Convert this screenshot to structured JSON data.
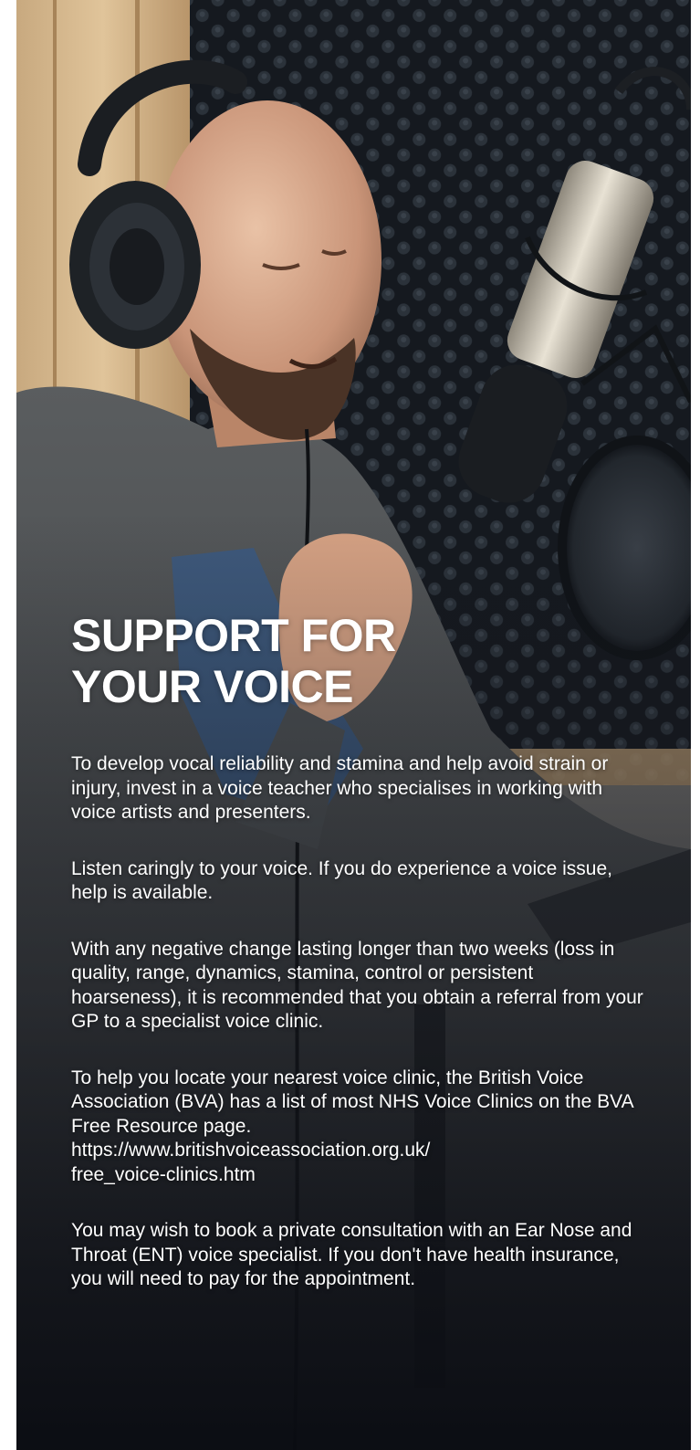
{
  "hero": {
    "heading": "SUPPORT FOR YOUR VOICE",
    "image_alt": "Man wearing headphones speaking into a studio microphone"
  },
  "paragraphs": [
    "To develop vocal reliability and stamina and help avoid strain or injury, invest in a voice teacher who specialises in working with voice artists and presenters.",
    "Listen caringly to your voice. If you do experience a voice issue, help is available.",
    "With any negative change lasting longer than two weeks (loss in quality, range, dynamics, stamina, control or persistent hoarseness), it is recommended that you obtain a referral from your GP to a specialist voice clinic.",
    "To help you locate your nearest voice clinic, the British Voice Association (BVA) has a list of most NHS Voice Clinics on the BVA Free Resource page.\nhttps://www.britishvoiceassociation.org.uk/\nfree_voice-clinics.htm",
    "You may wish to book a private consultation with an Ear Nose and Throat (ENT) voice specialist. If you don't have health insurance, you will need to pay for the appointment."
  ],
  "colors": {
    "text": "#ffffff",
    "background": "#2c3036"
  }
}
